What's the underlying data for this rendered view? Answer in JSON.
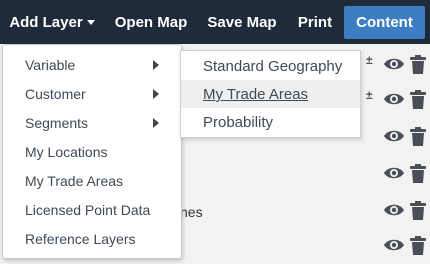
{
  "toolbar": {
    "add_layer": "Add Layer",
    "open_map": "Open Map",
    "save_map": "Save Map",
    "print": "Print",
    "content": "Content"
  },
  "menu": {
    "items": [
      {
        "label": "Variable"
      },
      {
        "label": "Customer"
      },
      {
        "label": "Segments"
      },
      {
        "label": "My Locations"
      },
      {
        "label": "My Trade Areas"
      },
      {
        "label": "Licensed Point Data"
      },
      {
        "label": "Reference Layers"
      }
    ]
  },
  "submenu": {
    "items": [
      {
        "label": "Standard Geography"
      },
      {
        "label": "My Trade Areas"
      },
      {
        "label": "Probability"
      }
    ]
  },
  "background": {
    "partial_text": "nes"
  },
  "colors": {
    "toolbar_bg": "#1f2b3a",
    "active_button": "#3d7ec2",
    "icon": "#4a4f57"
  }
}
